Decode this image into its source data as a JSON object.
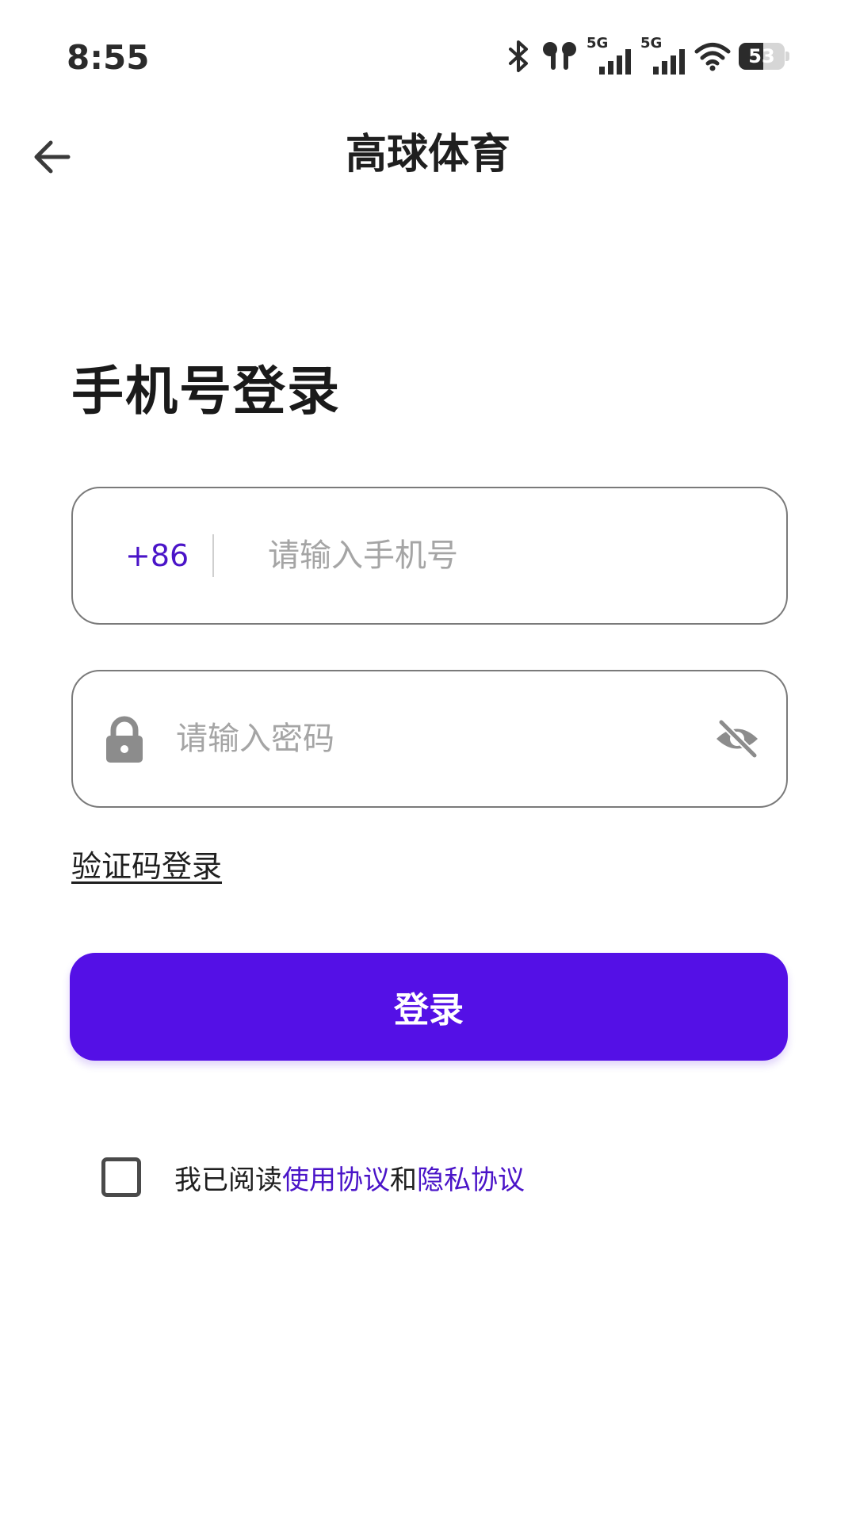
{
  "status_bar": {
    "time": "8:55",
    "network_1": "5G",
    "network_2": "5G",
    "battery_level": 53,
    "battery_text": "53",
    "icons": [
      "bluetooth-icon",
      "earbuds-icon",
      "signal-icon",
      "signal-icon",
      "wifi-icon",
      "battery-icon"
    ]
  },
  "app_bar": {
    "title": "高球体育",
    "back_icon": "arrow-left-icon"
  },
  "login": {
    "page_title": "手机号登录",
    "phone": {
      "country_code": "+86",
      "placeholder": "请输入手机号",
      "value": ""
    },
    "password": {
      "placeholder": "请输入密码",
      "value": "",
      "lock_icon": "lock-icon",
      "visibility_icon": "eye-off-icon"
    },
    "sms_login_link": "验证码登录",
    "submit_label": "登录"
  },
  "agreement": {
    "checked": false,
    "prefix": "我已阅读",
    "terms_link": "使用协议",
    "conjunction": "和",
    "privacy_link": "隐私协议"
  },
  "colors": {
    "primary": "#5410E6",
    "link": "#4A14C8",
    "border": "#7A7A7A",
    "placeholder": "#A5A5A5"
  }
}
